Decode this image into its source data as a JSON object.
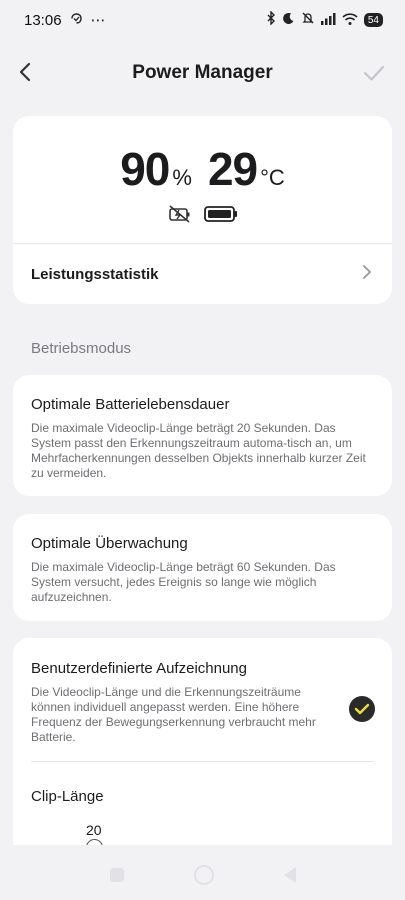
{
  "status_bar": {
    "time": "13:06",
    "extra": "⋯",
    "battery_level": "54",
    "icons": [
      "notification-icon",
      "bluetooth-icon",
      "moon-icon",
      "mute-icon",
      "signal-icon",
      "wifi-icon",
      "battery-icon"
    ]
  },
  "header": {
    "title": "Power Manager"
  },
  "status": {
    "battery_value": "90",
    "battery_unit": "%",
    "temp_value": "29",
    "temp_unit": "°C",
    "icons": [
      "no-charging-icon",
      "battery-full-icon"
    ],
    "stats_label": "Leistungsstatistik"
  },
  "section": {
    "label": "Betriebsmodus"
  },
  "modes": [
    {
      "title": "Optimale Batterielebensdauer",
      "desc": "Die maximale Videoclip-Länge beträgt 20 Sekunden. Das System passt den Erkennungszeitraum automa-tisch an, um Mehrfacherkennungen desselben Objekts innerhalb kurzer Zeit zu vermeiden."
    },
    {
      "title": "Optimale Überwachung",
      "desc": "Die maximale Videoclip-Länge beträgt 60 Sekunden. Das System versucht, jedes Ereignis so lange wie möglich aufzuzeichnen."
    },
    {
      "title": "Benutzerdefinierte Aufzeichnung",
      "desc": "Die Videoclip-Länge und die Erkennungszeiträume können individuell angepasst werden. Eine höhere Frequenz der Bewegungserkennung verbraucht mehr Batterie.",
      "selected": true
    }
  ],
  "clip": {
    "label": "Clip-Länge",
    "value": "20",
    "min": "10",
    "max": "120"
  },
  "colors": {
    "background": "#f2f2f5",
    "card": "#ffffff",
    "check_accent": "#e6e23a"
  }
}
